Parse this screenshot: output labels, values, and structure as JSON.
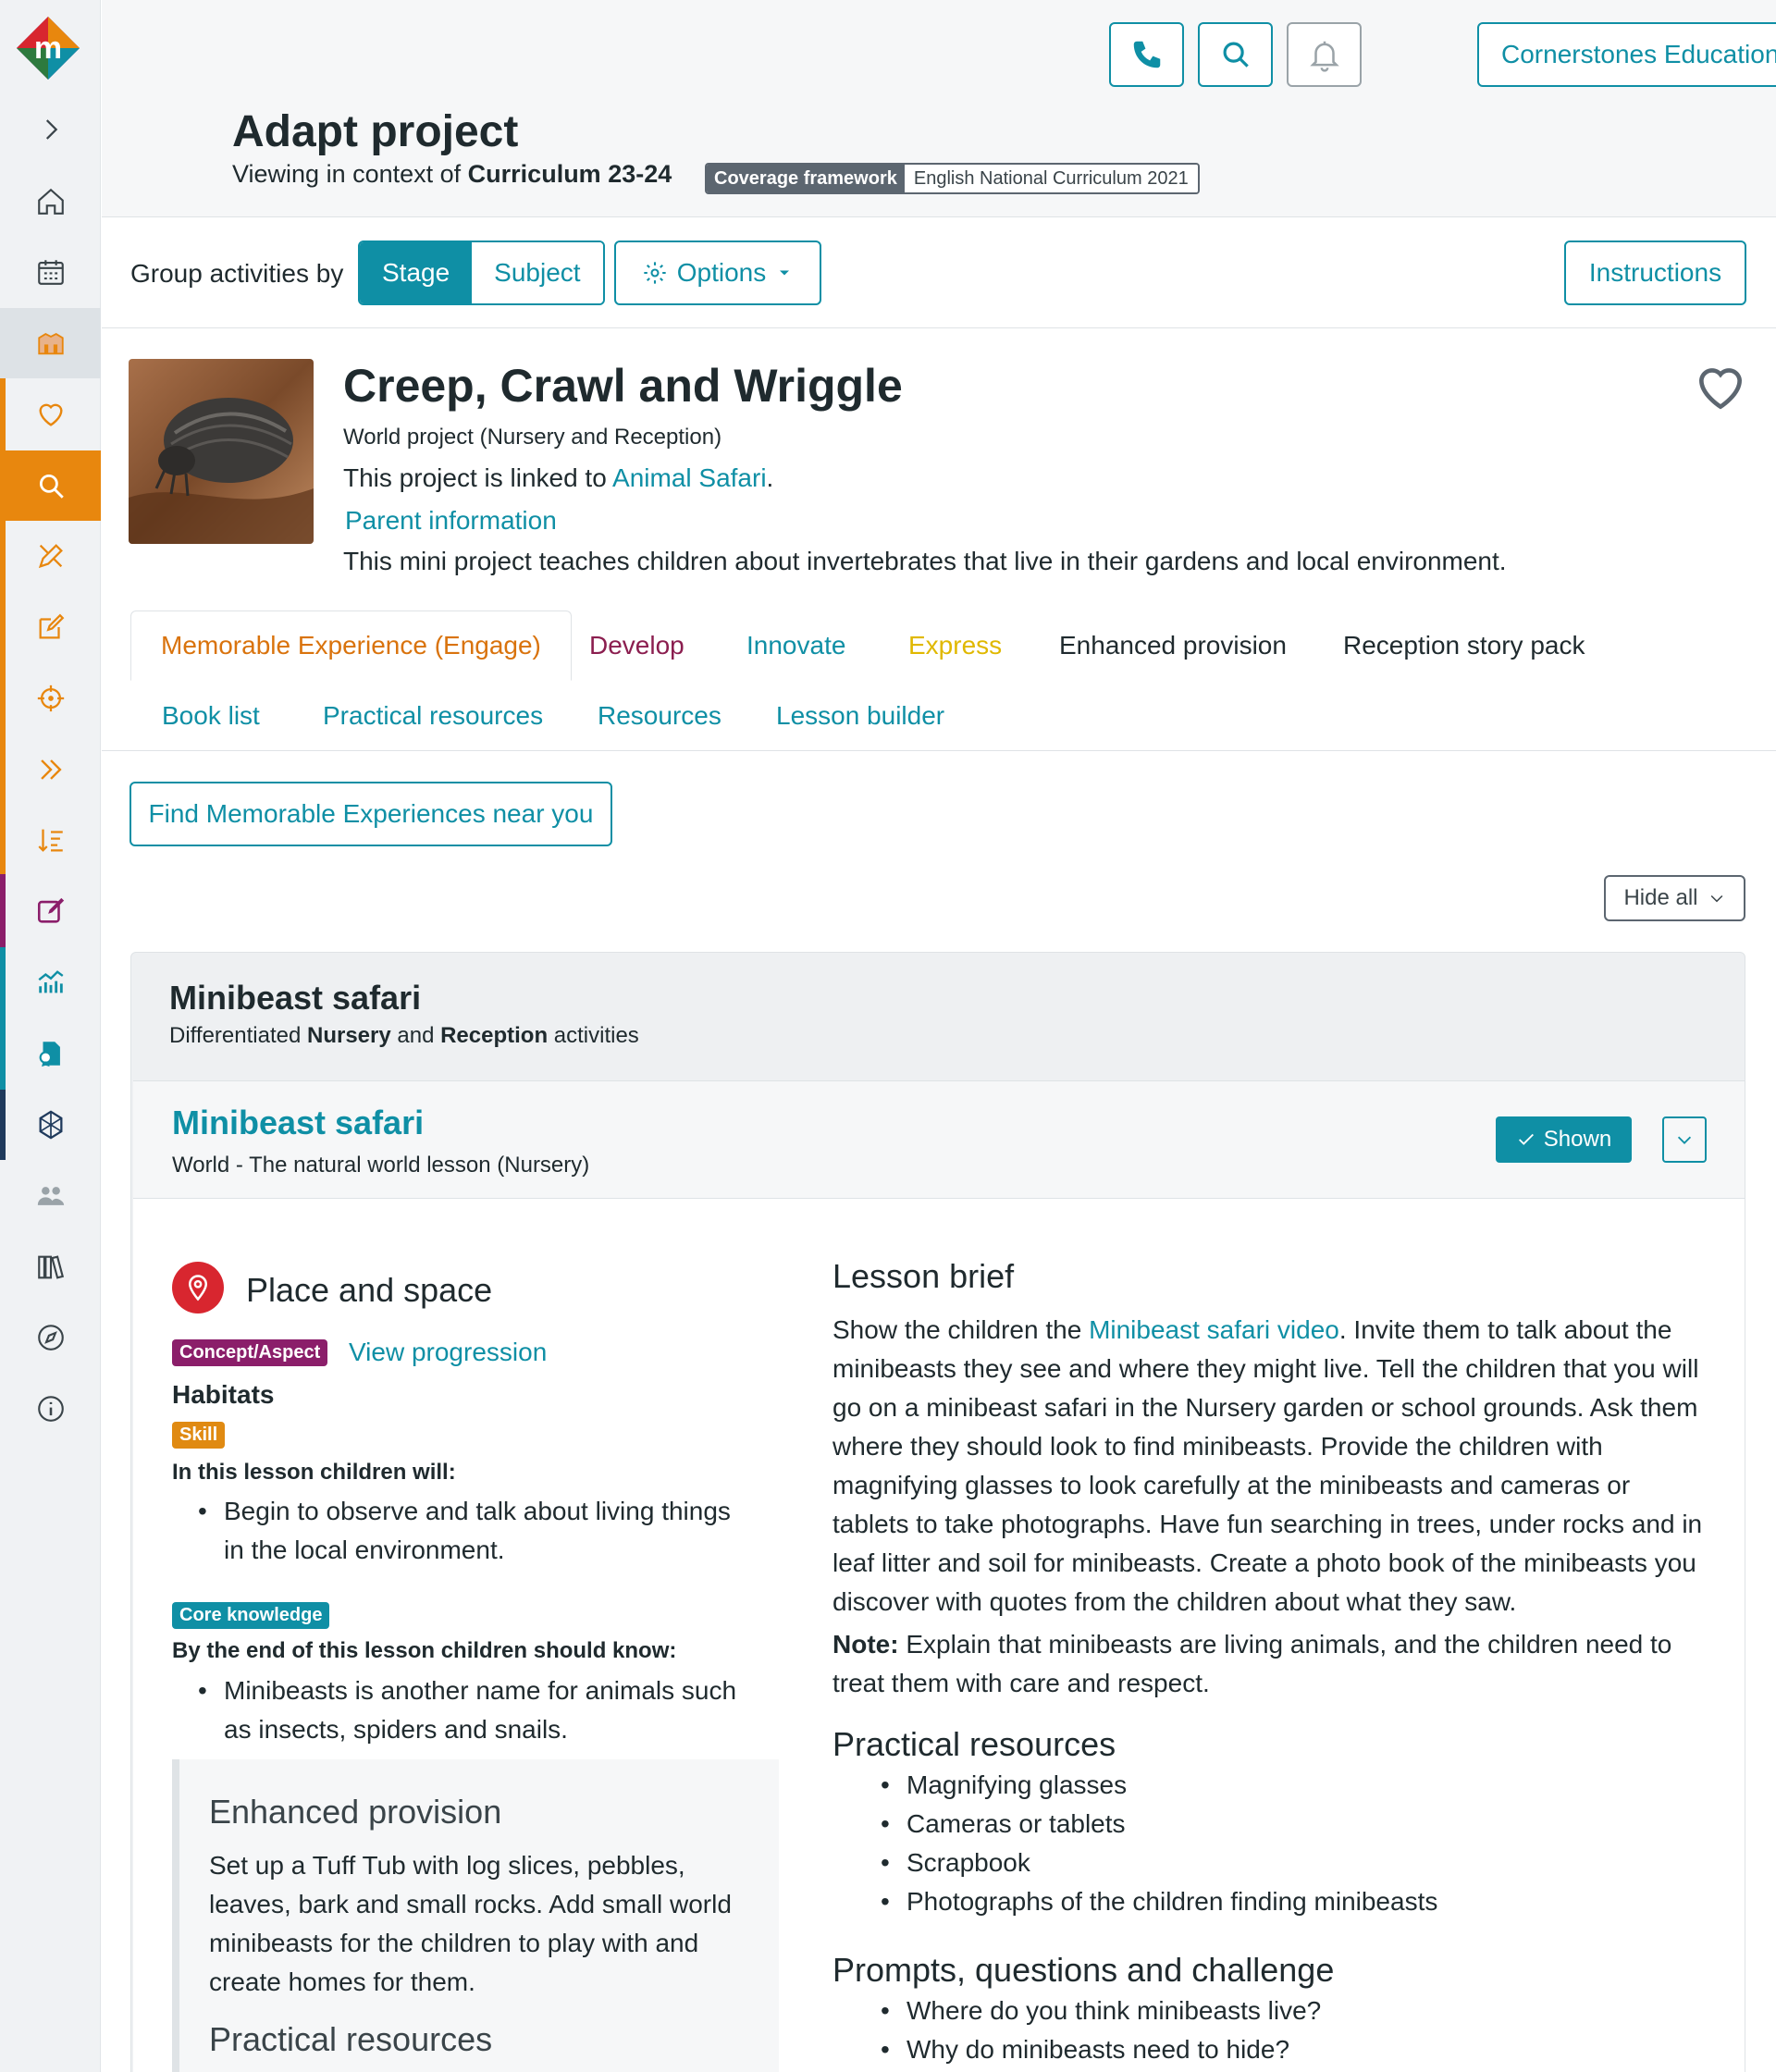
{
  "brand": {
    "logo_letter": "m",
    "accent": "#0f8fa5",
    "orange": "#e8870e"
  },
  "header": {
    "org_name": "Cornerstones Education",
    "page_title": "Adapt project",
    "context_prefix": "Viewing in context of",
    "context_value": "Curriculum 23-24",
    "framework_key": "Coverage framework",
    "framework_value": "English National Curriculum 2021"
  },
  "sidebar": {
    "items": [
      "chevron-right-icon",
      "home-icon",
      "calendar-icon",
      "projects-icon",
      "heart-icon",
      "search-icon",
      "pencil-ruler-icon",
      "edit-icon",
      "target-icon",
      "double-chevron-icon",
      "sort-icon",
      "assessment-edit-icon",
      "chart-icon",
      "certificate-icon",
      "network-icon",
      "users-icon",
      "library-icon",
      "compass-icon",
      "info-icon"
    ]
  },
  "toolbar": {
    "group_label": "Group activities by",
    "stage": "Stage",
    "subject": "Subject",
    "options": "Options",
    "instructions": "Instructions"
  },
  "project": {
    "title": "Creep, Crawl and Wriggle",
    "subtitle": "World project (Nursery and Reception)",
    "linked_prefix": "This project is linked to",
    "linked_name": "Animal Safari",
    "linked_suffix": ".",
    "parent_info": "Parent information",
    "description": "This mini project teaches children about invertebrates that live in their gardens and local environment."
  },
  "tabs": {
    "row1": [
      {
        "label": "Memorable Experience (Engage)",
        "color": "#d9730d"
      },
      {
        "label": "Develop",
        "color": "#8b1e4f"
      },
      {
        "label": "Innovate",
        "color": "#0f8fa5"
      },
      {
        "label": "Express",
        "color": "#e0b800"
      },
      {
        "label": "Enhanced provision",
        "color": "#1f2a2e"
      },
      {
        "label": "Reception story pack",
        "color": "#1f2a2e"
      }
    ],
    "row2": [
      {
        "label": "Book list"
      },
      {
        "label": "Practical resources"
      },
      {
        "label": "Resources"
      },
      {
        "label": "Lesson builder"
      }
    ]
  },
  "find_button": "Find Memorable Experiences near you",
  "hide_all": "Hide all",
  "group": {
    "title": "Minibeast safari",
    "sub_pre": "Differentiated",
    "sub_nursery": "Nursery",
    "sub_and": "and",
    "sub_reception": "Reception",
    "sub_post": "activities"
  },
  "activity": {
    "title": "Minibeast safari",
    "subtitle": "World - The natural world lesson (Nursery)",
    "shown": "Shown",
    "aspect": "Place and space",
    "concept_badge": "Concept/Aspect",
    "view_progression": "View progression",
    "concept": "Habitats",
    "skill_badge": "Skill",
    "will_label": "In this lesson children will:",
    "will_items": [
      "Begin to observe and talk about living things in the local environment."
    ],
    "core_badge": "Core knowledge",
    "know_label": "By the end of this lesson children should know:",
    "know_items": [
      "Minibeasts is another name for animals such as insects, spiders and snails."
    ],
    "enhanced_title": "Enhanced provision",
    "enhanced_text": "Set up a Tuff Tub with log slices, pebbles, leaves, bark and small rocks. Add small world minibeasts for the children to play with and create homes for them.",
    "enhanced_practical": "Practical resources",
    "brief_title": "Lesson brief",
    "brief_pre": "Show the children the",
    "brief_link": "Minibeast safari video",
    "brief_post": ". Invite them to talk about the minibeasts they see and where they might live. Tell the children that you will go on a minibeast safari in the Nursery garden or school grounds. Ask them where they should look to find minibeasts. Provide the children with magnifying glasses to look carefully at the minibeasts and cameras or tablets to take photographs. Have fun searching in trees, under rocks and in leaf litter and soil for minibeasts. Create a photo book of the minibeasts you discover with quotes from the children about what they saw.",
    "note_label": "Note:",
    "note_text": " Explain that minibeasts are living animals, and the children need to treat them with care and respect.",
    "practical_title": "Practical resources",
    "practical_items": [
      "Magnifying glasses",
      "Cameras or tablets",
      "Scrapbook",
      "Photographs of the children finding minibeasts"
    ],
    "prompts_title": "Prompts, questions and challenge",
    "prompts_items": [
      "Where do you think minibeasts live?",
      "Why do minibeasts need to hide?"
    ]
  }
}
